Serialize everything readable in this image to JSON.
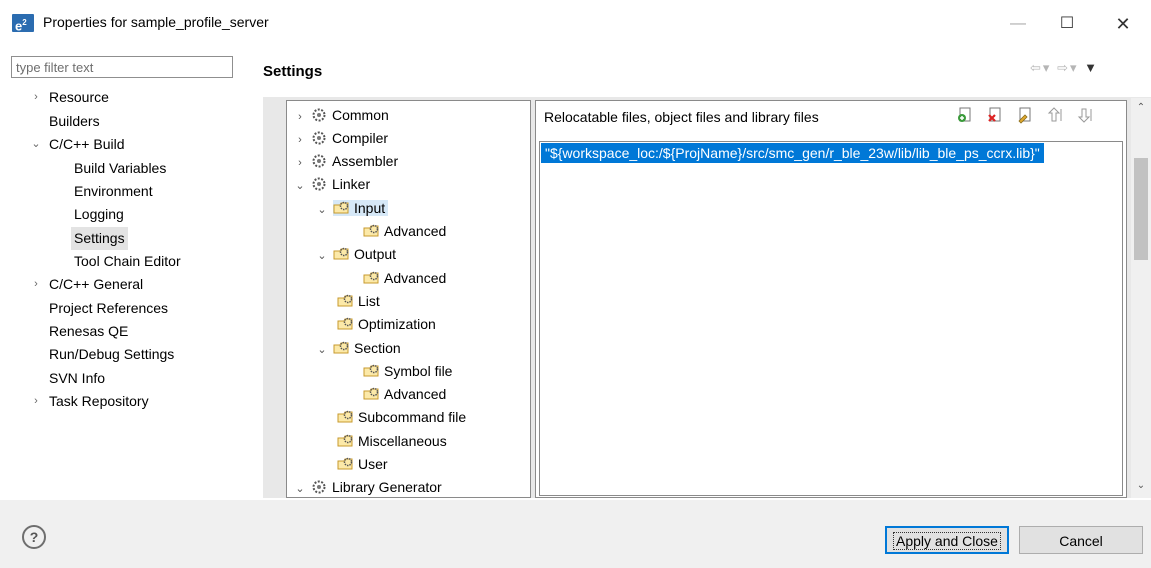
{
  "window": {
    "app_icon": "e²",
    "title": "Properties for sample_profile_server",
    "buttons": [
      "minimize",
      "maximize",
      "close"
    ]
  },
  "filter": {
    "placeholder": "type filter text"
  },
  "nav": {
    "items": [
      {
        "label": "Resource",
        "toggle": "›"
      },
      {
        "label": "Builders"
      },
      {
        "label": "C/C++ Build",
        "toggle": "⌄"
      },
      {
        "label": "Build Variables"
      },
      {
        "label": "Environment"
      },
      {
        "label": "Logging"
      },
      {
        "label": "Settings",
        "selected": true
      },
      {
        "label": "Tool Chain Editor"
      },
      {
        "label": "C/C++ General",
        "toggle": "›"
      },
      {
        "label": "Project References"
      },
      {
        "label": "Renesas QE"
      },
      {
        "label": "Run/Debug Settings"
      },
      {
        "label": "SVN Info"
      },
      {
        "label": "Task Repository",
        "toggle": "›"
      }
    ]
  },
  "page": {
    "title": "Settings"
  },
  "tool_tree": {
    "items": [
      {
        "label": "Common",
        "toggle": "›",
        "icon": "gear-icon"
      },
      {
        "label": "Compiler",
        "toggle": "›",
        "icon": "gear-icon"
      },
      {
        "label": "Assembler",
        "toggle": "›",
        "icon": "gear-icon"
      },
      {
        "label": "Linker",
        "toggle": "⌄",
        "icon": "gear-icon"
      },
      {
        "label": "Input",
        "toggle": "⌄",
        "icon": "folder-gear-icon",
        "selected": true
      },
      {
        "label": "Advanced",
        "icon": "folder-gear-icon"
      },
      {
        "label": "Output",
        "toggle": "⌄",
        "icon": "folder-gear-icon"
      },
      {
        "label": "Advanced",
        "icon": "folder-gear-icon"
      },
      {
        "label": "List",
        "icon": "folder-gear-icon"
      },
      {
        "label": "Optimization",
        "icon": "folder-gear-icon"
      },
      {
        "label": "Section",
        "toggle": "⌄",
        "icon": "folder-gear-icon"
      },
      {
        "label": "Symbol file",
        "icon": "folder-gear-icon"
      },
      {
        "label": "Advanced",
        "icon": "folder-gear-icon"
      },
      {
        "label": "Subcommand file",
        "icon": "folder-gear-icon"
      },
      {
        "label": "Miscellaneous",
        "icon": "folder-gear-icon"
      },
      {
        "label": "User",
        "icon": "folder-gear-icon"
      },
      {
        "label": "Library Generator",
        "toggle": "⌄",
        "icon": "gear-icon"
      }
    ]
  },
  "files_panel": {
    "header": "Relocatable files, object files and library files",
    "tools": [
      "add-icon",
      "delete-icon",
      "edit-icon",
      "move-up-icon",
      "move-down-icon"
    ],
    "entries": [
      "\"${workspace_loc:/${ProjName}/src/smc_gen/r_ble_23w/lib/lib_ble_ps_ccrx.lib}\""
    ]
  },
  "footer": {
    "help": "?",
    "apply_label": "Apply and Close",
    "cancel_label": "Cancel"
  },
  "colors": {
    "selection": "#0078d7",
    "tree_selection": "#d6e8f7"
  }
}
